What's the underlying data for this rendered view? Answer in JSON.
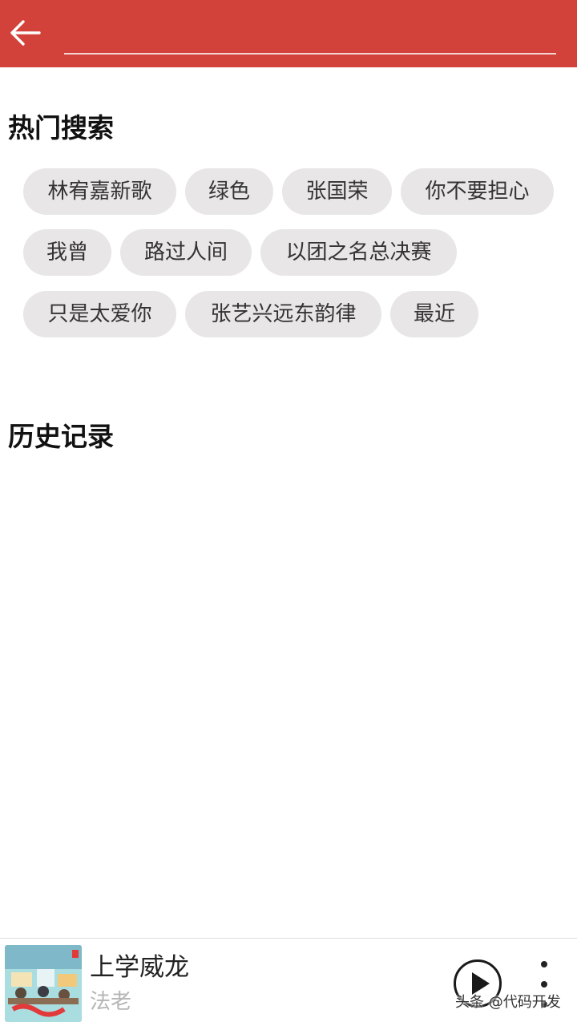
{
  "header": {
    "back_icon": "arrow-left-icon",
    "search": {
      "value": "",
      "placeholder": ""
    },
    "accent_color": "#d2423a"
  },
  "hot_search": {
    "title": "热门搜索",
    "tags": [
      "林宥嘉新歌",
      "绿色",
      "张国荣",
      "你不要担心",
      "我曾",
      "路过人间",
      "以团之名总决赛",
      "只是太爱你",
      "张艺兴远东韵律",
      "最近"
    ]
  },
  "history": {
    "title": "历史记录",
    "items": []
  },
  "player": {
    "song_title": "上学威龙",
    "artist": "法老",
    "play_icon": "play-icon",
    "more_icon": "more-vertical-icon"
  },
  "watermark": "头条 @代码开发"
}
